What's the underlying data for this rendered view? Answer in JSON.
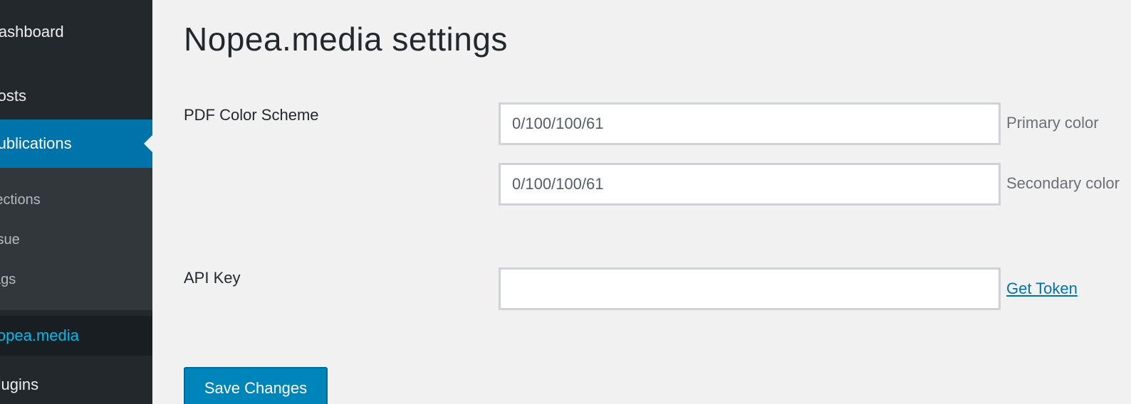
{
  "sidebar": {
    "items": [
      {
        "label": "Dashboard"
      },
      {
        "label": "Posts"
      },
      {
        "label": "Publications",
        "active": true
      },
      {
        "label": "Sections"
      },
      {
        "label": "Issue"
      },
      {
        "label": "Tags"
      },
      {
        "label": "Nopea.media",
        "current": true
      },
      {
        "label": "Plugins"
      }
    ]
  },
  "main": {
    "title": "Nopea.media settings",
    "pdf_color_scheme": {
      "label": "PDF Color Scheme",
      "primary_value": "0/100/100/61",
      "primary_desc": "Primary color",
      "secondary_value": "0/100/100/61",
      "secondary_desc": "Secondary color"
    },
    "api_key": {
      "label": "API Key",
      "value": "",
      "link": "Get Token"
    },
    "save_label": "Save Changes"
  },
  "colors": {
    "sidebar_bg": "#23282d",
    "active_bg": "#0073aa",
    "submenu_bg": "#32373c",
    "current_text": "#00b9eb",
    "primary_button": "#0085ba",
    "page_bg": "#f1f1f1"
  }
}
